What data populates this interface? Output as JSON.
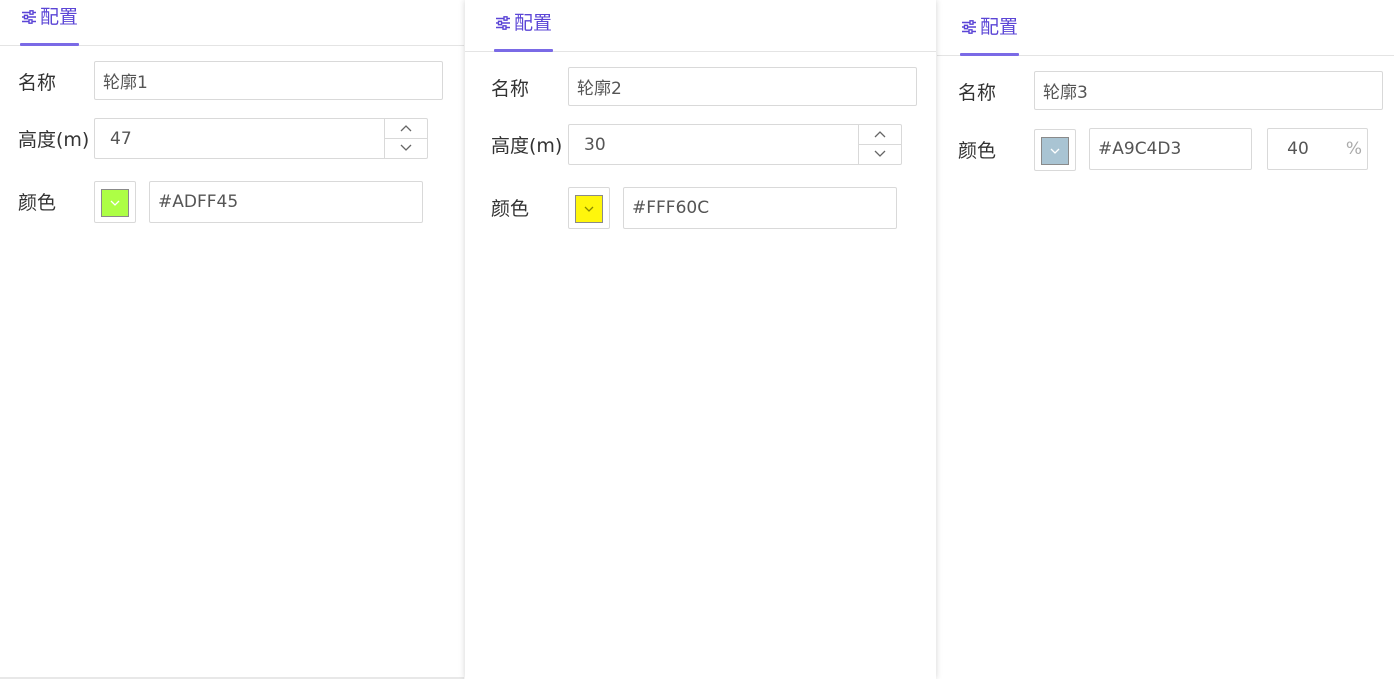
{
  "panels": [
    {
      "tab_label": "配置",
      "fields": {
        "name_label": "名称",
        "name_value": "轮廓1",
        "height_label": "高度(m)",
        "height_value": "47",
        "color_label": "颜色",
        "color_hex": "#ADFF45"
      },
      "swatch_color": "#ADFF45"
    },
    {
      "tab_label": "配置",
      "fields": {
        "name_label": "名称",
        "name_value": "轮廓2",
        "height_label": "高度(m)",
        "height_value": "30",
        "color_label": "颜色",
        "color_hex": "#FFF60C"
      },
      "swatch_color": "#FFF60C"
    },
    {
      "tab_label": "配置",
      "fields": {
        "name_label": "名称",
        "name_value": "轮廓3",
        "color_label": "颜色",
        "color_hex": "#A9C4D3",
        "opacity_value": "40",
        "opacity_unit": "%"
      },
      "swatch_color": "#A9C4D3"
    }
  ],
  "accent_color": "#5B45D6",
  "icons": {
    "tab": "sliders-icon",
    "spin_up": "chevron-up-icon",
    "spin_down": "chevron-down-icon",
    "swatch_dropdown": "chevron-down-icon"
  }
}
